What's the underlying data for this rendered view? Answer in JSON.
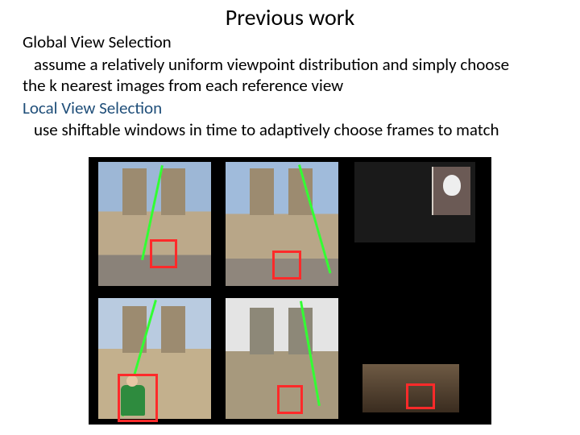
{
  "title": "Previous work",
  "global_heading": "Global View Selection",
  "global_body_l1": "assume a relatively uniform viewpoint distribution and simply choose",
  "global_body_l2": "the k nearest images from each reference view",
  "local_heading": "Local View Selection",
  "local_body": "use shiftable windows in time to adaptively choose frames to match"
}
